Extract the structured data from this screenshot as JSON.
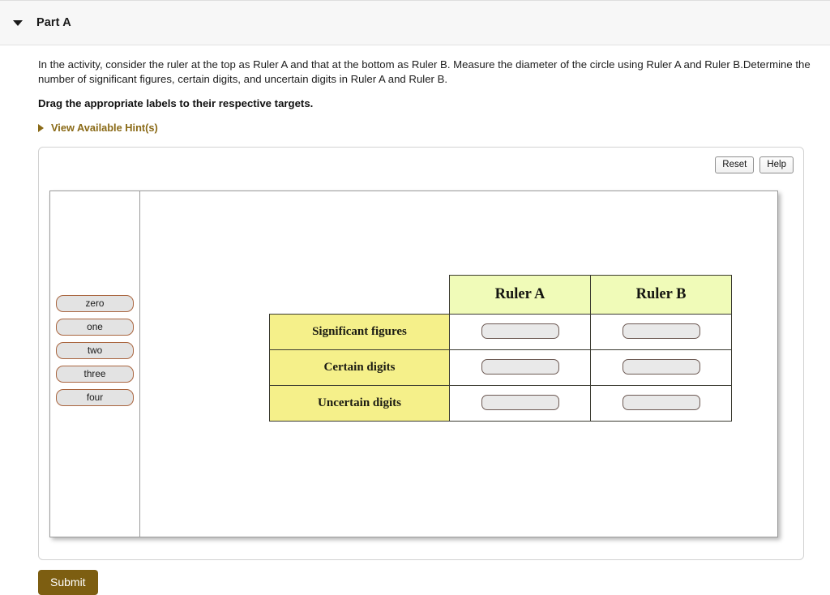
{
  "part": {
    "title": "Part A",
    "collapse_icon": "triangle-down-icon"
  },
  "prompt": {
    "body": "In the activity, consider the ruler at the top as Ruler A and that at the bottom as Ruler B. Measure the diameter of the circle using Ruler A and Ruler B.Determine the number of significant figures, certain digits, and uncertain digits in Ruler A and Ruler B.",
    "instruction": "Drag the appropriate labels to their respective targets.",
    "hint_link": "View Available Hint(s)",
    "hint_icon": "triangle-right-icon"
  },
  "toolbar": {
    "reset_label": "Reset",
    "help_label": "Help"
  },
  "label_bank": {
    "items": [
      {
        "label": "zero"
      },
      {
        "label": "one"
      },
      {
        "label": "two"
      },
      {
        "label": "three"
      },
      {
        "label": "four"
      }
    ]
  },
  "matrix": {
    "corner": "",
    "columns": [
      {
        "label": "Ruler A"
      },
      {
        "label": "Ruler B"
      }
    ],
    "rows": [
      {
        "label": "Significant figures",
        "ruler_a": "",
        "ruler_b": ""
      },
      {
        "label": "Certain digits",
        "ruler_a": "",
        "ruler_b": ""
      },
      {
        "label": "Uncertain digits",
        "ruler_a": "",
        "ruler_b": ""
      }
    ]
  },
  "footer": {
    "submit_label": "Submit"
  },
  "colors": {
    "accent_brown": "#7d5e11",
    "hint_link": "#8a6a17",
    "header_cell": "#f0fbb8",
    "row_label_cell": "#f5f08a",
    "chip_border": "#a9653f",
    "chip_fill": "#e3e3e3",
    "slot_fill": "#e9e9e9"
  }
}
